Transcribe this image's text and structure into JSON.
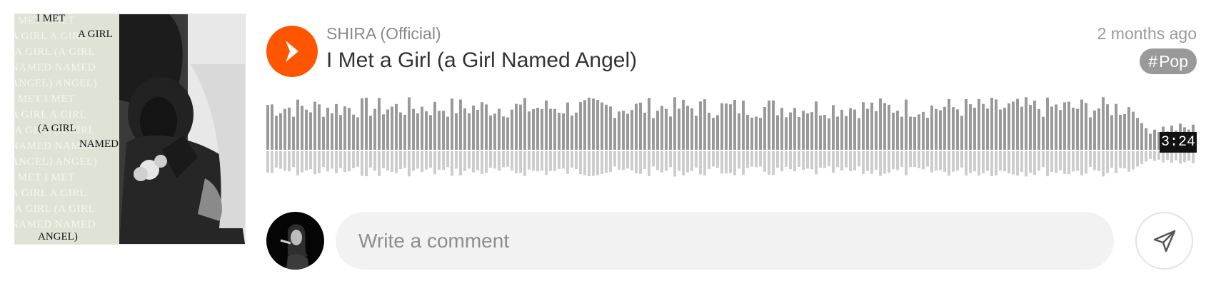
{
  "artwork": {
    "ghost_lines": [
      "I MET   I MET",
      "A GIRL  A GIRL",
      "(A GIRL (A GIRL",
      "NAMED  NAMED",
      "ANGEL) ANGEL)"
    ],
    "words": [
      "I MET",
      "A GIRL",
      "(A GIRL",
      "NAMED",
      "ANGEL)"
    ]
  },
  "track": {
    "artist": "SHIRA (Official)",
    "title": "I Met a Girl (a Girl Named Angel)",
    "time_ago": "2 months ago",
    "tag_hash": "#",
    "tag": "Pop",
    "duration": "3:24",
    "accent_color": "#ff5500"
  },
  "comment": {
    "placeholder": "Write a comment"
  },
  "icons": {
    "play": "play-icon",
    "send": "send-icon",
    "avatar": "user-avatar"
  }
}
